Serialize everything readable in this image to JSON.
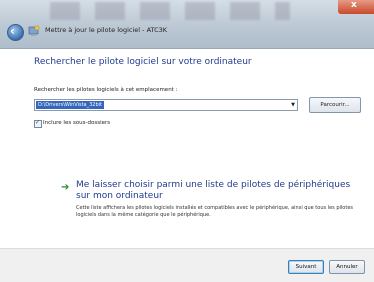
{
  "window": {
    "title": "Mettre à jour le pilote logiciel - ATC3K",
    "close_glyph": "x"
  },
  "main": {
    "heading": "Rechercher le pilote logiciel sur votre ordinateur",
    "location_label": "Rechercher les pilotes logiciels à cet emplacement :",
    "location_value": "D:\\Drivers\\WinVista_32bit",
    "browse_label": "Parcourir...",
    "include_subfolders_label": "Inclure les sous-dossiers",
    "include_subfolders_checked": true,
    "option_title": "Me laisser choisir parmi une liste de pilotes de périphériques sur mon ordinateur",
    "option_description": "Cette liste affichera les pilotes logiciels installés et compatibles avec le périphérique, ainsi que tous les pilotes logiciels dans la même catégorie que le périphérique."
  },
  "footer": {
    "next_label": "Suivant",
    "cancel_label": "Annuler"
  },
  "colors": {
    "heading": "#1f3b8f",
    "selection": "#3466bc",
    "arrow": "#2e8a2e"
  },
  "icons": {
    "back": "back-arrow-icon",
    "app": "driver-update-icon",
    "option": "green-arrow-icon"
  }
}
